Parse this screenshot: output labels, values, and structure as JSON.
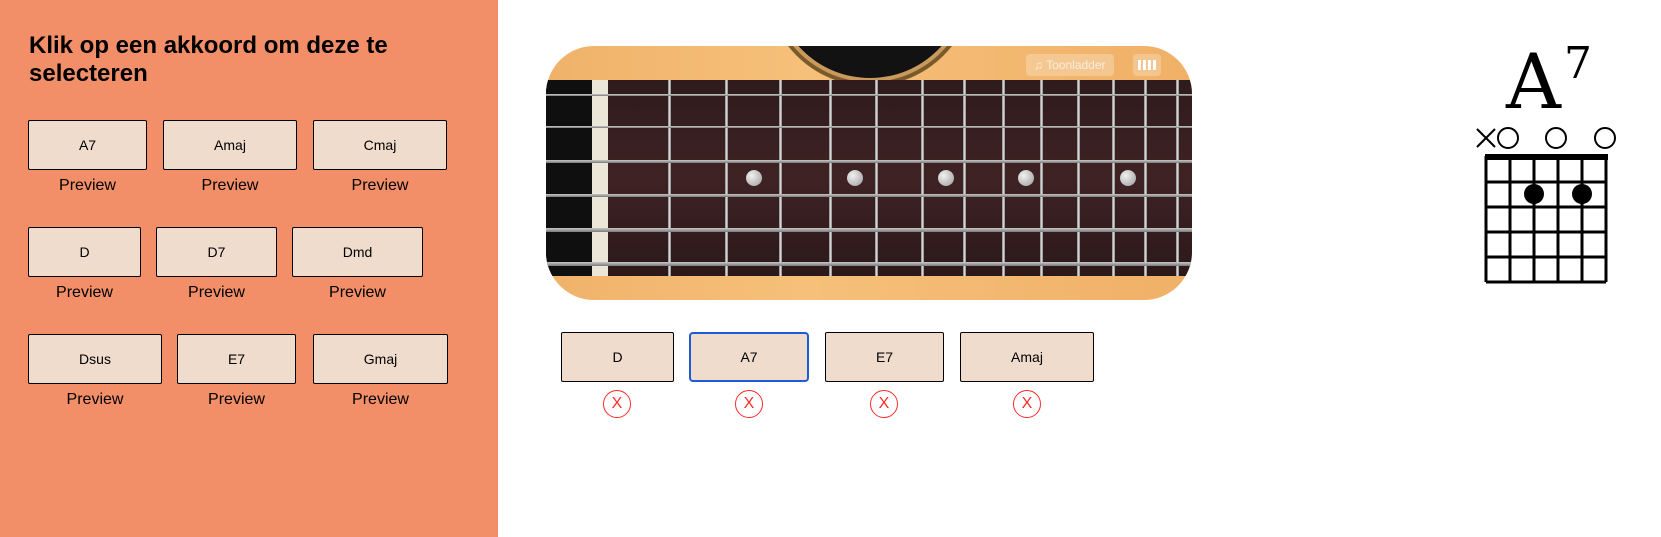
{
  "sidebar": {
    "heading": "Klik op een akkoord om deze te selecteren",
    "chords": [
      {
        "label": "A7",
        "preview": "Preview"
      },
      {
        "label": "Amaj",
        "preview": "Preview"
      },
      {
        "label": "Cmaj",
        "preview": "Preview"
      },
      {
        "label": "D",
        "preview": "Preview"
      },
      {
        "label": "D7",
        "preview": "Preview"
      },
      {
        "label": "Dmd",
        "preview": "Preview"
      },
      {
        "label": "Dsus",
        "preview": "Preview"
      },
      {
        "label": "E7",
        "preview": "Preview"
      },
      {
        "label": "Gmaj",
        "preview": "Preview"
      }
    ]
  },
  "guitar": {
    "scale_label": "Toonladder",
    "scale_icon": "music-notes-icon",
    "view_icon": "bars-icon"
  },
  "selected": {
    "chords": [
      {
        "label": "D",
        "remove": "X"
      },
      {
        "label": "A7",
        "remove": "X"
      },
      {
        "label": "E7",
        "remove": "X"
      },
      {
        "label": "Amaj",
        "remove": "X"
      }
    ],
    "active_index": 1
  },
  "diagram": {
    "chord_root": "A",
    "chord_extension": "7",
    "string_markers": [
      "x",
      "o",
      "",
      "o",
      "",
      "o"
    ]
  },
  "colors": {
    "sidebar_bg": "#f28f69",
    "button_bg": "#efdccd",
    "active_border": "#1e5bd6",
    "remove_red": "#ff2a2a"
  }
}
